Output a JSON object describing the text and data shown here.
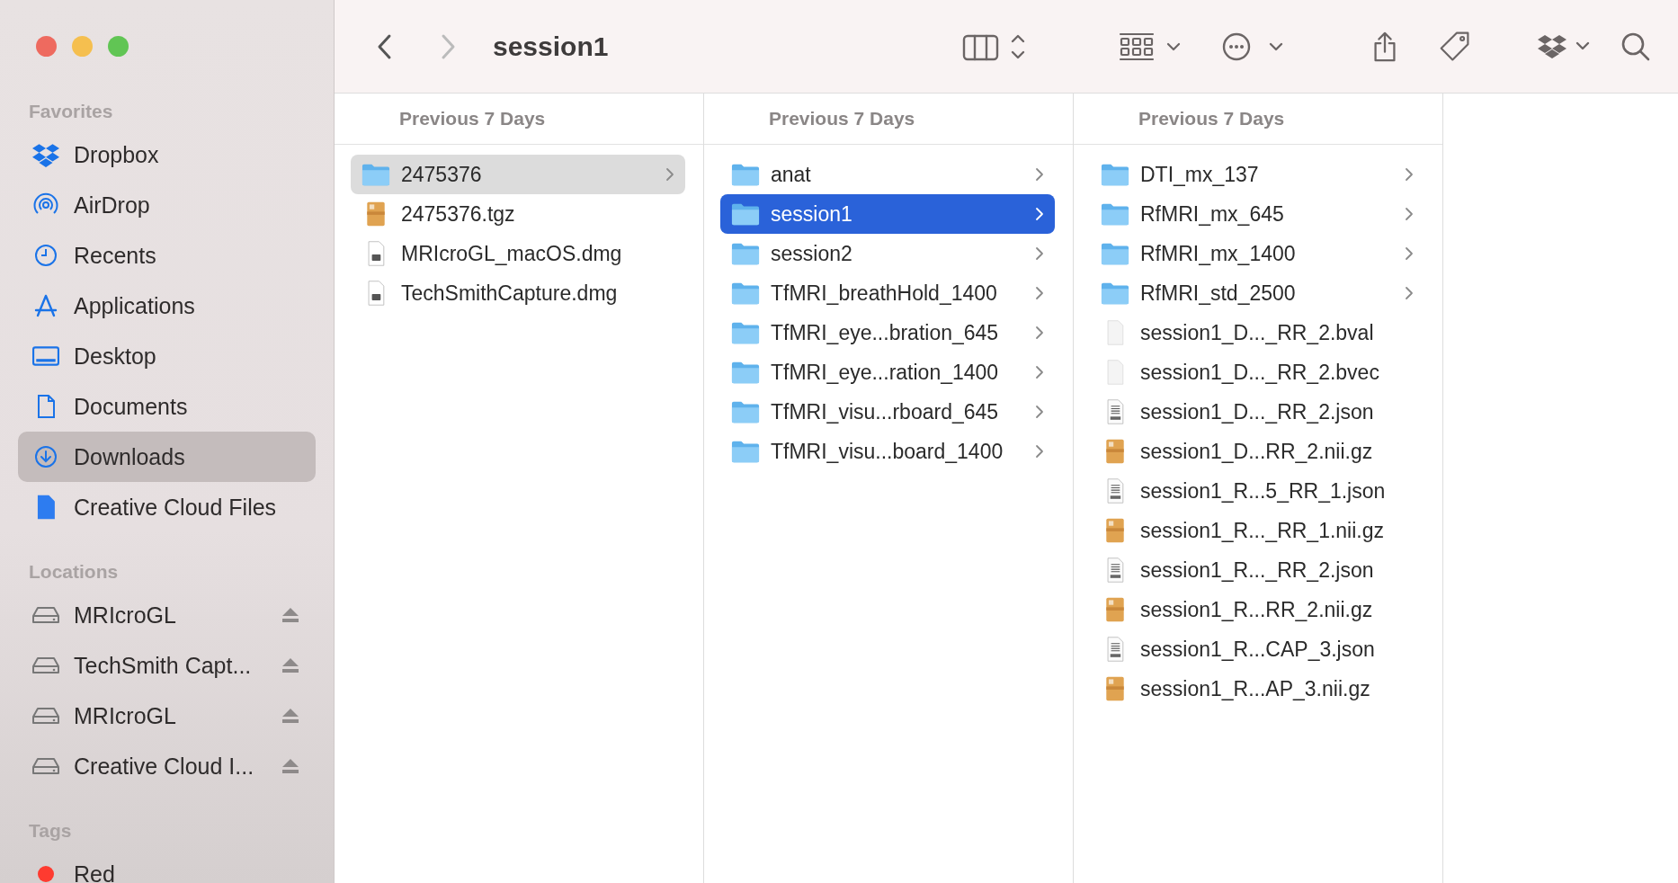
{
  "window": {
    "title": "session1"
  },
  "navigation": {
    "back": {
      "disabled": false
    },
    "forward": {
      "disabled": true
    }
  },
  "sidebar": {
    "sections": [
      {
        "heading": "Favorites",
        "items": [
          {
            "label": "Dropbox",
            "kind": "dropbox",
            "selected": false
          },
          {
            "label": "AirDrop",
            "kind": "airdrop",
            "selected": false
          },
          {
            "label": "Recents",
            "kind": "clock",
            "selected": false
          },
          {
            "label": "Applications",
            "kind": "apps",
            "selected": false
          },
          {
            "label": "Desktop",
            "kind": "desktop",
            "selected": false
          },
          {
            "label": "Documents",
            "kind": "document",
            "selected": false
          },
          {
            "label": "Downloads",
            "kind": "download",
            "selected": true
          },
          {
            "label": "Creative Cloud Files",
            "kind": "file",
            "selected": false
          }
        ]
      },
      {
        "heading": "Locations",
        "items": [
          {
            "label": "MRIcroGL",
            "kind": "disk",
            "selected": false,
            "ejectable": true
          },
          {
            "label": "TechSmith Capt...",
            "kind": "disk",
            "selected": false,
            "ejectable": true
          },
          {
            "label": "MRIcroGL",
            "kind": "disk",
            "selected": false,
            "ejectable": true
          },
          {
            "label": "Creative Cloud I...",
            "kind": "disk",
            "selected": false,
            "ejectable": true
          }
        ]
      },
      {
        "heading": "Tags",
        "items": [
          {
            "label": "Red",
            "kind": "tag",
            "color": "#fe3b30",
            "selected": false
          }
        ]
      }
    ]
  },
  "columns": [
    {
      "header": "Previous 7 Days",
      "items": [
        {
          "name": "2475376",
          "kind": "folder",
          "selected": true,
          "active": false
        },
        {
          "name": "2475376.tgz",
          "kind": "archive",
          "selected": false
        },
        {
          "name": "MRIcroGL_macOS.dmg",
          "kind": "disk-image",
          "selected": false
        },
        {
          "name": "TechSmithCapture.dmg",
          "kind": "disk-image",
          "selected": false
        }
      ]
    },
    {
      "header": "Previous 7 Days",
      "items": [
        {
          "name": "anat",
          "kind": "folder",
          "selected": false
        },
        {
          "name": "session1",
          "kind": "folder",
          "selected": true,
          "active": true
        },
        {
          "name": "session2",
          "kind": "folder",
          "selected": false
        },
        {
          "name": "TfMRI_breathHold_1400",
          "kind": "folder",
          "selected": false
        },
        {
          "name": "TfMRI_eye...bration_645",
          "kind": "folder",
          "selected": false
        },
        {
          "name": "TfMRI_eye...ration_1400",
          "kind": "folder",
          "selected": false
        },
        {
          "name": "TfMRI_visu...rboard_645",
          "kind": "folder",
          "selected": false
        },
        {
          "name": "TfMRI_visu...board_1400",
          "kind": "folder",
          "selected": false
        }
      ]
    },
    {
      "header": "Previous 7 Days",
      "items": [
        {
          "name": "DTI_mx_137",
          "kind": "folder",
          "selected": false
        },
        {
          "name": "RfMRI_mx_645",
          "kind": "folder",
          "selected": false
        },
        {
          "name": "RfMRI_mx_1400",
          "kind": "folder",
          "selected": false
        },
        {
          "name": "RfMRI_std_2500",
          "kind": "folder",
          "selected": false
        },
        {
          "name": "session1_D..._RR_2.bval",
          "kind": "blank",
          "selected": false
        },
        {
          "name": "session1_D..._RR_2.bvec",
          "kind": "blank",
          "selected": false
        },
        {
          "name": "session1_D..._RR_2.json",
          "kind": "json",
          "selected": false
        },
        {
          "name": "session1_D...RR_2.nii.gz",
          "kind": "archive",
          "selected": false
        },
        {
          "name": "session1_R...5_RR_1.json",
          "kind": "json",
          "selected": false
        },
        {
          "name": "session1_R..._RR_1.nii.gz",
          "kind": "archive",
          "selected": false
        },
        {
          "name": "session1_R..._RR_2.json",
          "kind": "json",
          "selected": false
        },
        {
          "name": "session1_R...RR_2.nii.gz",
          "kind": "archive",
          "selected": false
        },
        {
          "name": "session1_R...CAP_3.json",
          "kind": "json",
          "selected": false
        },
        {
          "name": "session1_R...AP_3.nii.gz",
          "kind": "archive",
          "selected": false
        }
      ]
    }
  ]
}
